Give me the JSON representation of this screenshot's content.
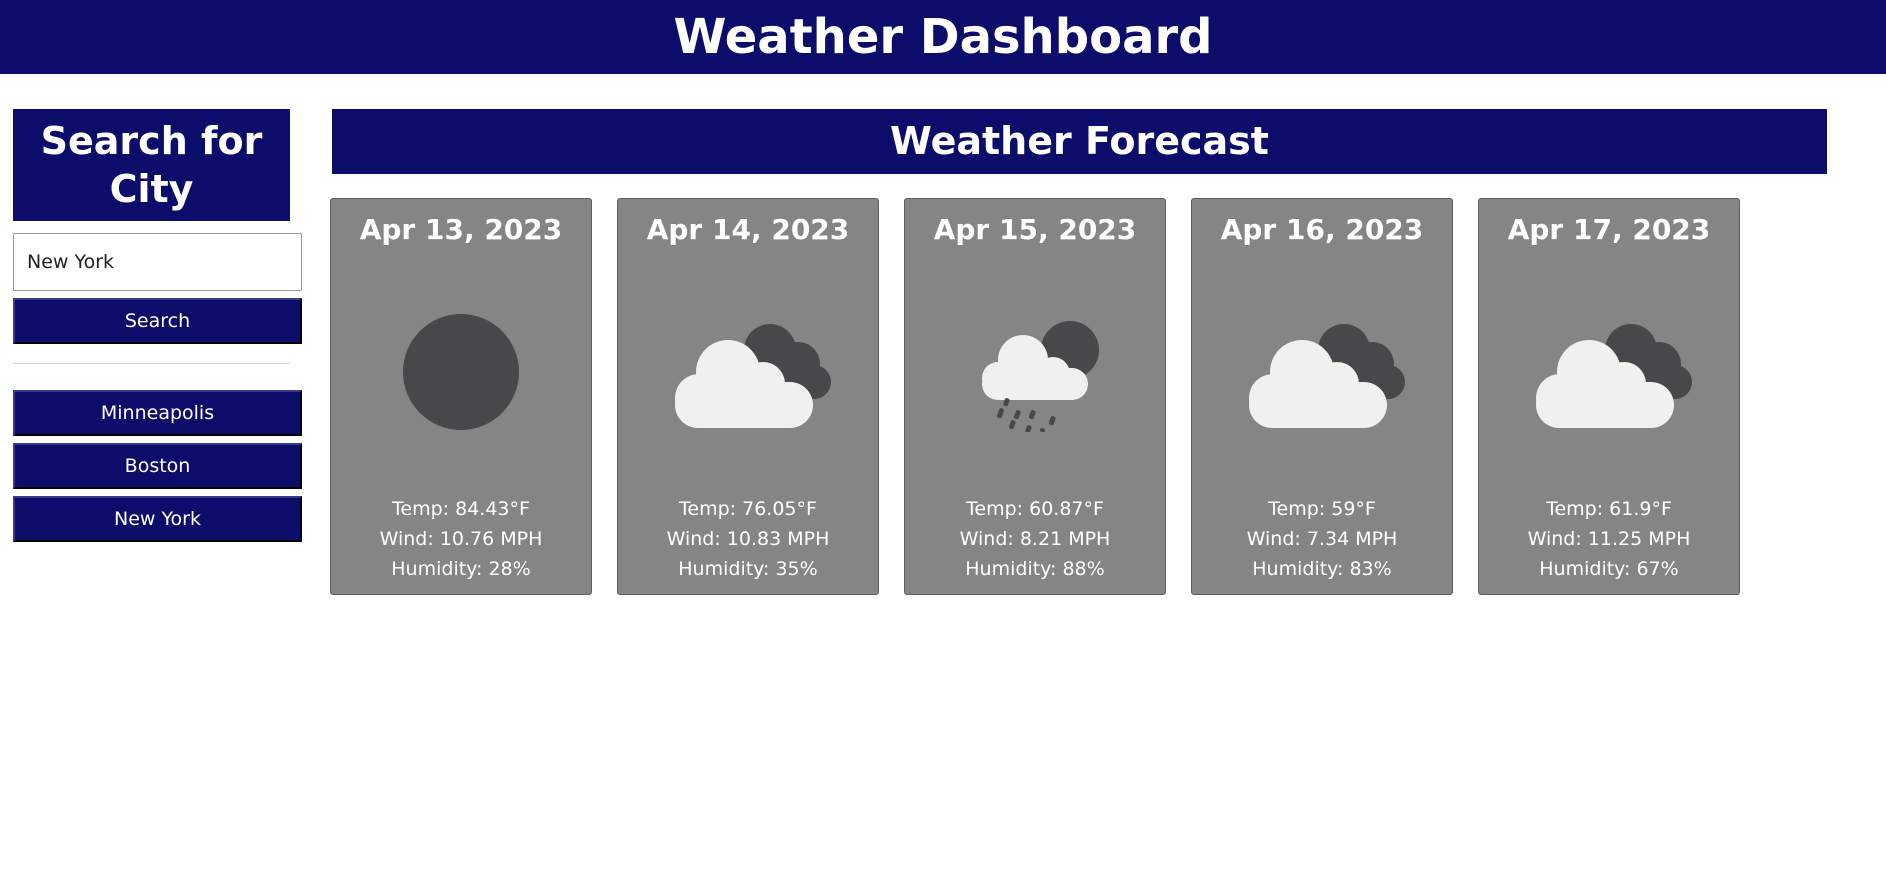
{
  "header": {
    "title": "Weather Dashboard"
  },
  "sidebar": {
    "title": "Search for City",
    "search_input": {
      "value": "New York",
      "placeholder": ""
    },
    "search_button": "Search",
    "history": [
      "Minneapolis",
      "Boston",
      "New York"
    ]
  },
  "main": {
    "title": "Weather Forecast",
    "cards": [
      {
        "date": "Apr 13, 2023",
        "icon": "sun-icon",
        "temp": "Temp: 84.43°F",
        "wind": "Wind: 10.76 MPH",
        "humidity": "Humidity: 28%"
      },
      {
        "date": "Apr 14, 2023",
        "icon": "cloudy-icon",
        "temp": "Temp: 76.05°F",
        "wind": "Wind: 10.83 MPH",
        "humidity": "Humidity: 35%"
      },
      {
        "date": "Apr 15, 2023",
        "icon": "rain-icon",
        "temp": "Temp: 60.87°F",
        "wind": "Wind: 8.21 MPH",
        "humidity": "Humidity: 88%"
      },
      {
        "date": "Apr 16, 2023",
        "icon": "cloudy-icon",
        "temp": "Temp: 59°F",
        "wind": "Wind: 7.34 MPH",
        "humidity": "Humidity: 83%"
      },
      {
        "date": "Apr 17, 2023",
        "icon": "cloudy-icon",
        "temp": "Temp: 61.9°F",
        "wind": "Wind: 11.25 MPH",
        "humidity": "Humidity: 67%"
      }
    ]
  },
  "colors": {
    "brand": "#0c0c6b",
    "card_bg": "#858585",
    "icon_dark": "#48484a",
    "cloud_light": "#f0f0ee"
  }
}
